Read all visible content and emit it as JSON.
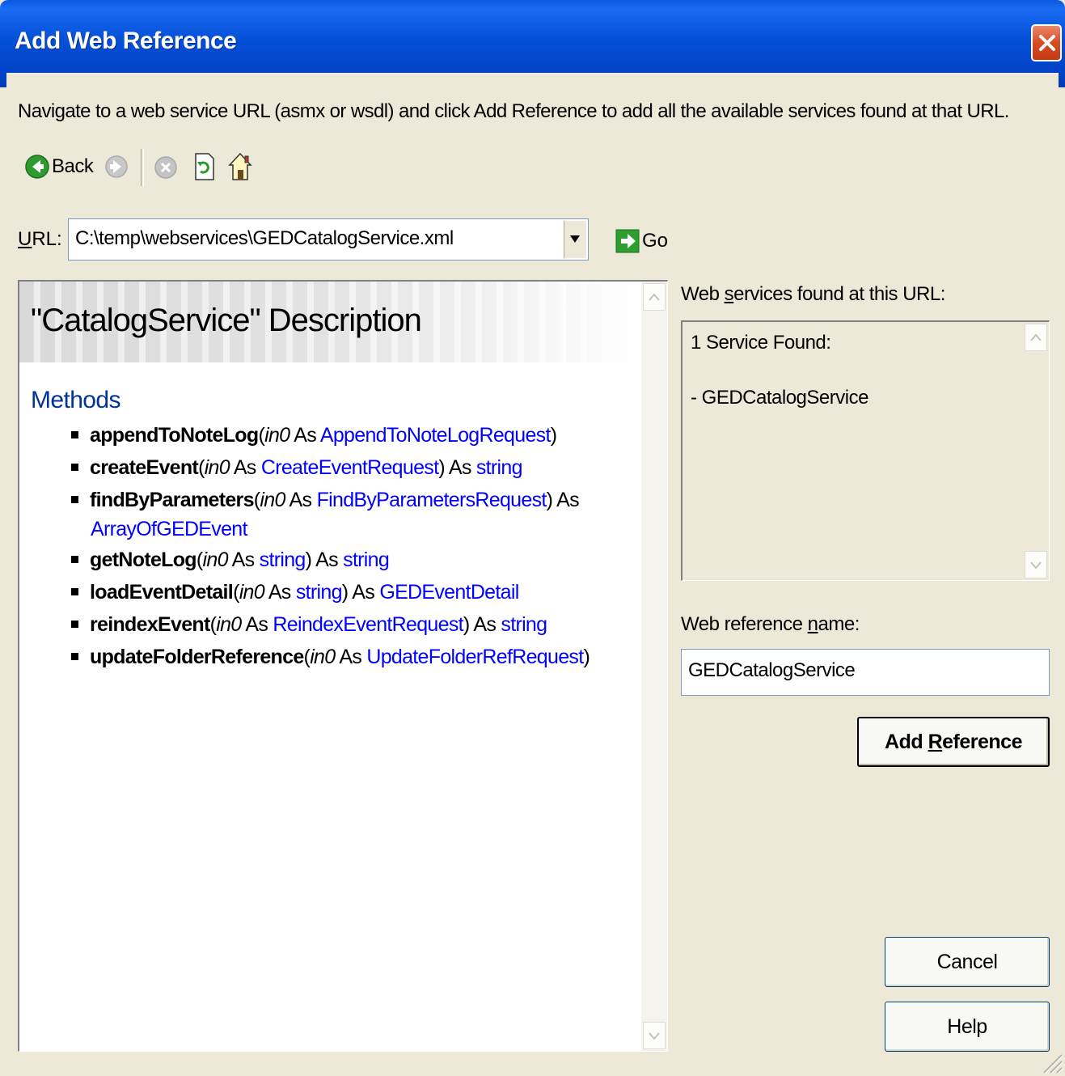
{
  "window": {
    "title": "Add Web Reference"
  },
  "instructions": "Navigate to a web service URL (asmx or wsdl) and click Add Reference to add all the available services found at that URL.",
  "toolbar": {
    "back_label": "Back",
    "icons": [
      "back-arrow-icon",
      "forward-arrow-icon",
      "stop-icon",
      "refresh-icon",
      "home-icon"
    ]
  },
  "url": {
    "label_prefix": "U",
    "label_rest": "RL:",
    "value": "C:\\temp\\webservices\\GEDCatalogService.xml",
    "go_label": "Go"
  },
  "description": {
    "title": "\"CatalogService\" Description",
    "methods_heading": "Methods",
    "methods": [
      {
        "name": "appendToNoteLog",
        "open": "(",
        "param": "in0",
        "as1": " As ",
        "type": "AppendToNoteLogRequest",
        "close": ")",
        "as2": "",
        "ret": "",
        "ret_wrap": ""
      },
      {
        "name": "createEvent",
        "open": "(",
        "param": "in0",
        "as1": " As ",
        "type": "CreateEventRequest",
        "close": ")",
        "as2": " As ",
        "ret": "string",
        "ret_wrap": ""
      },
      {
        "name": "findByParameters",
        "open": "(",
        "param": "in0",
        "as1": " As ",
        "type": "FindByParametersRequest",
        "close": ")",
        "as2": " As",
        "ret": "",
        "ret_wrap": "ArrayOfGEDEvent"
      },
      {
        "name": "getNoteLog",
        "open": "(",
        "param": "in0",
        "as1": " As ",
        "type": "string",
        "close": ")",
        "as2": " As ",
        "ret": "string",
        "ret_wrap": ""
      },
      {
        "name": "loadEventDetail",
        "open": "(",
        "param": "in0",
        "as1": " As ",
        "type": "string",
        "close": ")",
        "as2": " As ",
        "ret": "GEDEventDetail",
        "ret_wrap": ""
      },
      {
        "name": "reindexEvent",
        "open": "(",
        "param": "in0",
        "as1": " As ",
        "type": "ReindexEventRequest",
        "close": ")",
        "as2": " As ",
        "ret": "string",
        "ret_wrap": ""
      },
      {
        "name": "updateFolderReference",
        "open": "(",
        "param": "in0",
        "as1": " As ",
        "type": "UpdateFolderRefRequest",
        "close": ")",
        "as2": "",
        "ret": "",
        "ret_wrap": ""
      }
    ]
  },
  "services": {
    "label_pre": "Web ",
    "label_u": "s",
    "label_post": "ervices found at this URL:",
    "count_text": "1 Service Found:",
    "items": [
      "- GEDCatalogService"
    ]
  },
  "reference": {
    "label_pre": "Web reference ",
    "label_u": "n",
    "label_post": "ame:",
    "value": "GEDCatalogService"
  },
  "buttons": {
    "add_pre": "Add ",
    "add_u": "R",
    "add_post": "eference",
    "cancel": "Cancel",
    "help": "Help"
  },
  "colors": {
    "titlebar": "#0550d8",
    "dialog_bg": "#ece9d8",
    "link": "#0000ff",
    "methods_heading": "#003399"
  }
}
